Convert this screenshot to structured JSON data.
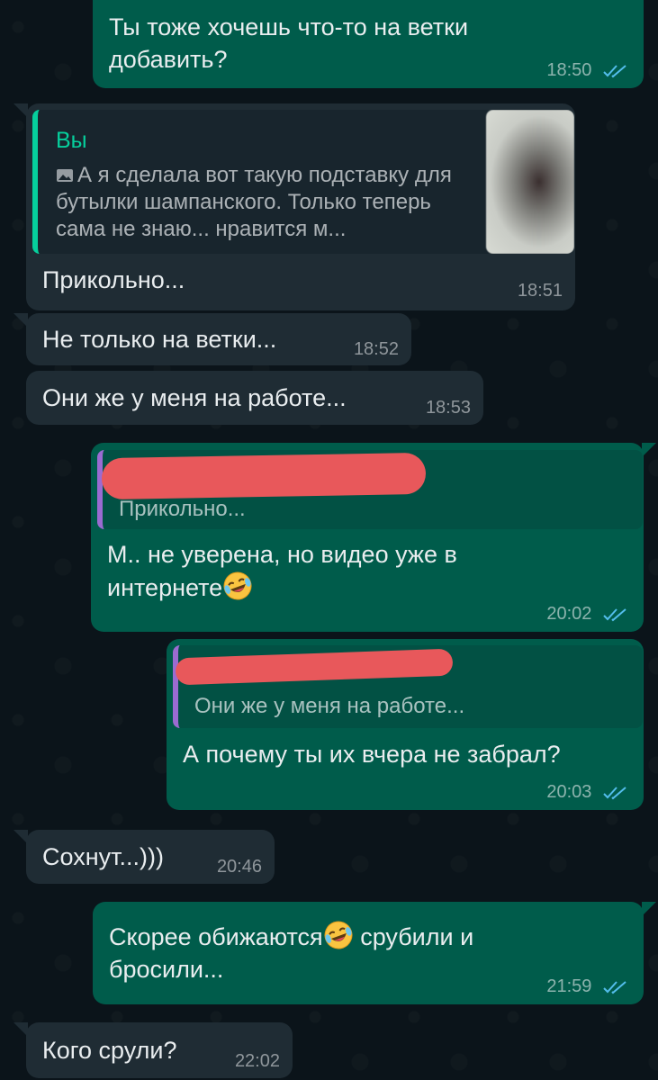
{
  "chat": {
    "msg1": {
      "text": "Ты тоже хочешь что-то на ветки добавить?",
      "time": "18:50"
    },
    "msg2": {
      "reply_author": "Вы",
      "reply_text": "А я сделала вот такую подставку для бутылки шампанского. Только теперь сама не знаю... нравится м...",
      "text": "Прикольно...",
      "time": "18:51"
    },
    "msg3": {
      "text": "Не только на ветки...",
      "time": "18:52"
    },
    "msg4": {
      "text": "Они же у меня на работе...",
      "time": "18:53"
    },
    "msg5": {
      "reply_text": "Прикольно...",
      "text_line1": "М.. не уверена, но видео уже в",
      "text_line2": "интернете",
      "time": "20:02"
    },
    "msg6": {
      "reply_text": "Они же у меня на работе...",
      "text": "А почему ты их вчера не забрал?",
      "time": "20:03"
    },
    "msg7": {
      "text": "Сохнут...)))",
      "time": "20:46"
    },
    "msg8": {
      "text_part1": "Скорее обижаются",
      "text_part2": "срубили и",
      "text_line2": "бросили...",
      "time": "21:59"
    },
    "msg9": {
      "text": "Кого срули?",
      "time": "22:02"
    }
  },
  "colors": {
    "outgoing": "#005c4b",
    "incoming": "#1f2c34",
    "read_ticks": "#53bdeb",
    "redaction": "#e8585b"
  },
  "icons": {
    "read_receipt": "double-check-icon",
    "emoji": "rolling-on-floor-laughing-emoji",
    "photo": "photo-icon"
  }
}
